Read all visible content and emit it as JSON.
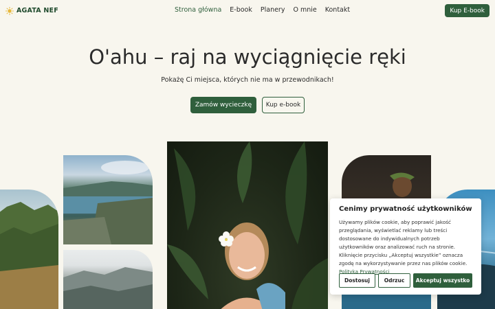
{
  "header": {
    "logo_text": "AGATA NEF",
    "nav": [
      {
        "label": "Strona główna",
        "active": true
      },
      {
        "label": "E-book",
        "active": false
      },
      {
        "label": "Planery",
        "active": false
      },
      {
        "label": "O mnie",
        "active": false
      },
      {
        "label": "Kontakt",
        "active": false
      }
    ],
    "cta_label": "Kup E-book"
  },
  "hero": {
    "title": "O'ahu – raj na wyciągnięcie ręki",
    "subtitle": "Pokażę Ci miejsca, których nie ma w przewodnikach!",
    "primary_button": "Zamów wycieczkę",
    "secondary_button": "Kup e-book"
  },
  "cookie": {
    "title": "Cenimy prywatność użytkowników",
    "text": "Używamy plików cookie, aby poprawić jakość przeglądania, wyświetlać reklamy lub treści dostosowane do indywidualnych potrzeb użytkowników oraz analizować ruch na stronie. Kliknięcie przycisku „Akceptuj wszystkie” oznacza zgodę na wykorzystywanie przez nas plików cookie.",
    "link": "Polityka Prywatności",
    "customize": "Dostosuj",
    "reject": "Odrzuc",
    "accept": "Akceptuj wszystko"
  },
  "colors": {
    "brand_green": "#2f5f3c",
    "background": "#f8f6ee",
    "logo_sun": "#e7b83a"
  },
  "icons": {
    "logo": "sun-icon"
  }
}
